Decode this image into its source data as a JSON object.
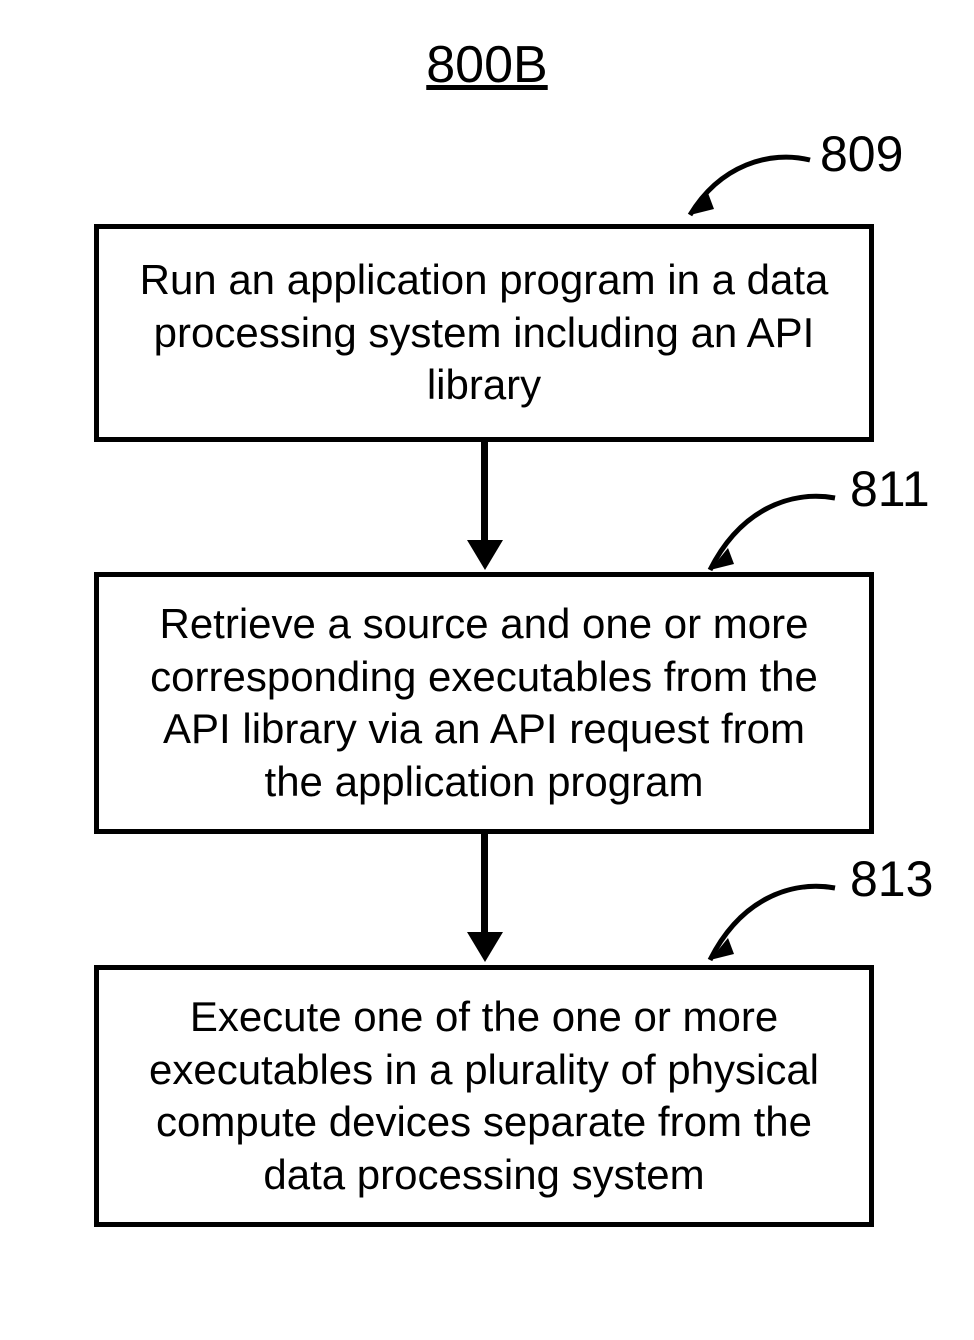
{
  "title": "800B",
  "steps": [
    {
      "id": "809",
      "text": "Run an application program in a data processing system including an API library"
    },
    {
      "id": "811",
      "text": "Retrieve a source and one or more corresponding executables from the API library via an API request from the application program"
    },
    {
      "id": "813",
      "text": "Execute one of the one or more executables in a plurality of physical compute devices separate from the data processing system"
    }
  ]
}
